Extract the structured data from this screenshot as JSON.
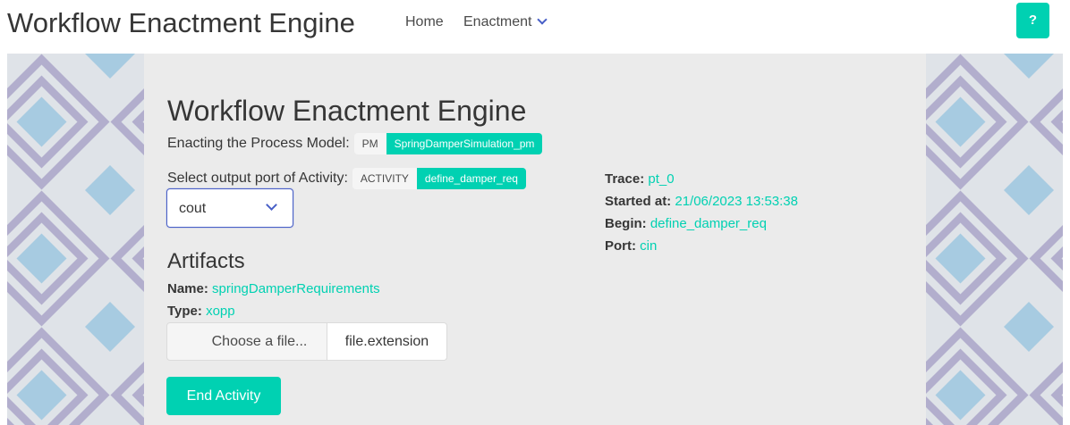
{
  "navbar": {
    "brand": "Workflow Enactment Engine",
    "home": "Home",
    "enactment": "Enactment",
    "help": "?"
  },
  "main": {
    "title": "Workflow Enactment Engine",
    "process_model_label": "Enacting the Process Model:",
    "pm_tag": "PM",
    "pm_value": "SpringDamperSimulation_pm",
    "activity_label": "Select output port of Activity:",
    "activity_tag": "ACTIVITY",
    "activity_value": "define_damper_req",
    "port_select": {
      "selected": "cout"
    },
    "artifacts": {
      "title": "Artifacts",
      "name_label": "Name:",
      "name_value": "springDamperRequirements",
      "type_label": "Type:",
      "type_value": "xopp",
      "file_button": "Choose a file...",
      "file_name": "file.extension"
    },
    "end_button": "End Activity",
    "info": {
      "trace_label": "Trace:",
      "trace_value": "pt_0",
      "started_label": "Started at:",
      "started_value": "21/06/2023 13:53:38",
      "begin_label": "Begin:",
      "begin_value": "define_damper_req",
      "port_label": "Port:",
      "port_value": "cin"
    }
  },
  "colors": {
    "primary": "#00d1b2",
    "link": "#485fc7",
    "panel": "#ebebeb",
    "pattern_light": "#dfe3e8",
    "pattern_purple": "#b2aecd",
    "pattern_blue": "#a7cbe1"
  },
  "icons": [
    "chevron-down-icon"
  ]
}
